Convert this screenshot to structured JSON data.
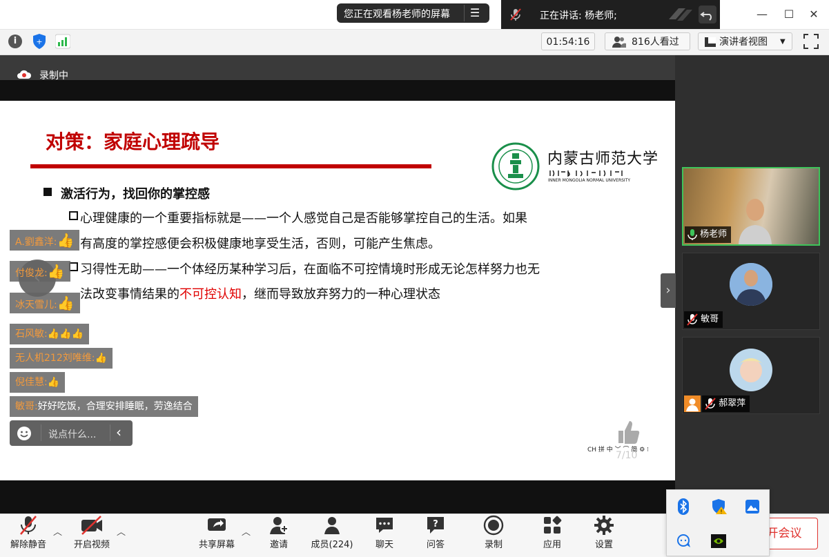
{
  "window": {
    "viewing_banner": "您正在观看杨老师的屏幕",
    "speaking": "正在讲话: 杨老师;",
    "timer": "01:54:16",
    "viewers": "816人看过",
    "view_mode": "演讲者视图"
  },
  "recording": {
    "label": "录制中"
  },
  "slide": {
    "title": "对策：家庭心理疏导",
    "heading": "激活行为，找回你的掌控感",
    "p1_line1": "心理健康的一个重要指标就是——一个人感觉自己是否能够掌控自己的生活。如果",
    "p1_line2": "有高度的掌控感便会积极健康地享受生活，否则，可能产生焦虑。",
    "p2_line1": "习得性无助——一个体经历某种学习后，在面临不可控情境时形成无论怎样努力也无",
    "p2_line2_pre": "法改变事情结果的",
    "p2_line2_red": "不可控认知",
    "p2_line2_post": "，继而导致放弃努力的一种心理状态",
    "university_cn": "内蒙古师范大学",
    "university_en": "INNER MONGOLIA NORMAL UNIVERSITY",
    "page": "7/10",
    "ime": "CH 拼 中 ﹀ ⌒ 简 ⚙ ⁝",
    "accent": "#c00000"
  },
  "chat": [
    {
      "name": "A.劉鑫洋:",
      "msg": "👍"
    },
    {
      "name": "付俊龙:",
      "msg": "👍"
    },
    {
      "name": "冰天雪儿:",
      "msg": "👍"
    },
    {
      "name": "石风敏:",
      "msg": "👍👍👍"
    },
    {
      "name": "无人机212刘唯维:",
      "msg": "👍"
    },
    {
      "name": "倪佳慧:",
      "msg": "👍"
    },
    {
      "name": "敏哥:",
      "msg": "好好吃饭，合理安排睡眠，劳逸结合"
    }
  ],
  "chat_input": {
    "placeholder": "说点什么..."
  },
  "participants": [
    {
      "name": "杨老师",
      "mic": "on"
    },
    {
      "name": "敏哥",
      "mic": "muted"
    },
    {
      "name": "郝翠萍",
      "mic": "muted"
    }
  ],
  "toolbar": {
    "mute": "解除静音",
    "video": "开启视频",
    "share": "共享屏幕",
    "invite": "邀请",
    "members": "成员(224)",
    "chat": "聊天",
    "qa": "问答",
    "record": "录制",
    "apps": "应用",
    "settings": "设置",
    "leave": "离开会议"
  }
}
